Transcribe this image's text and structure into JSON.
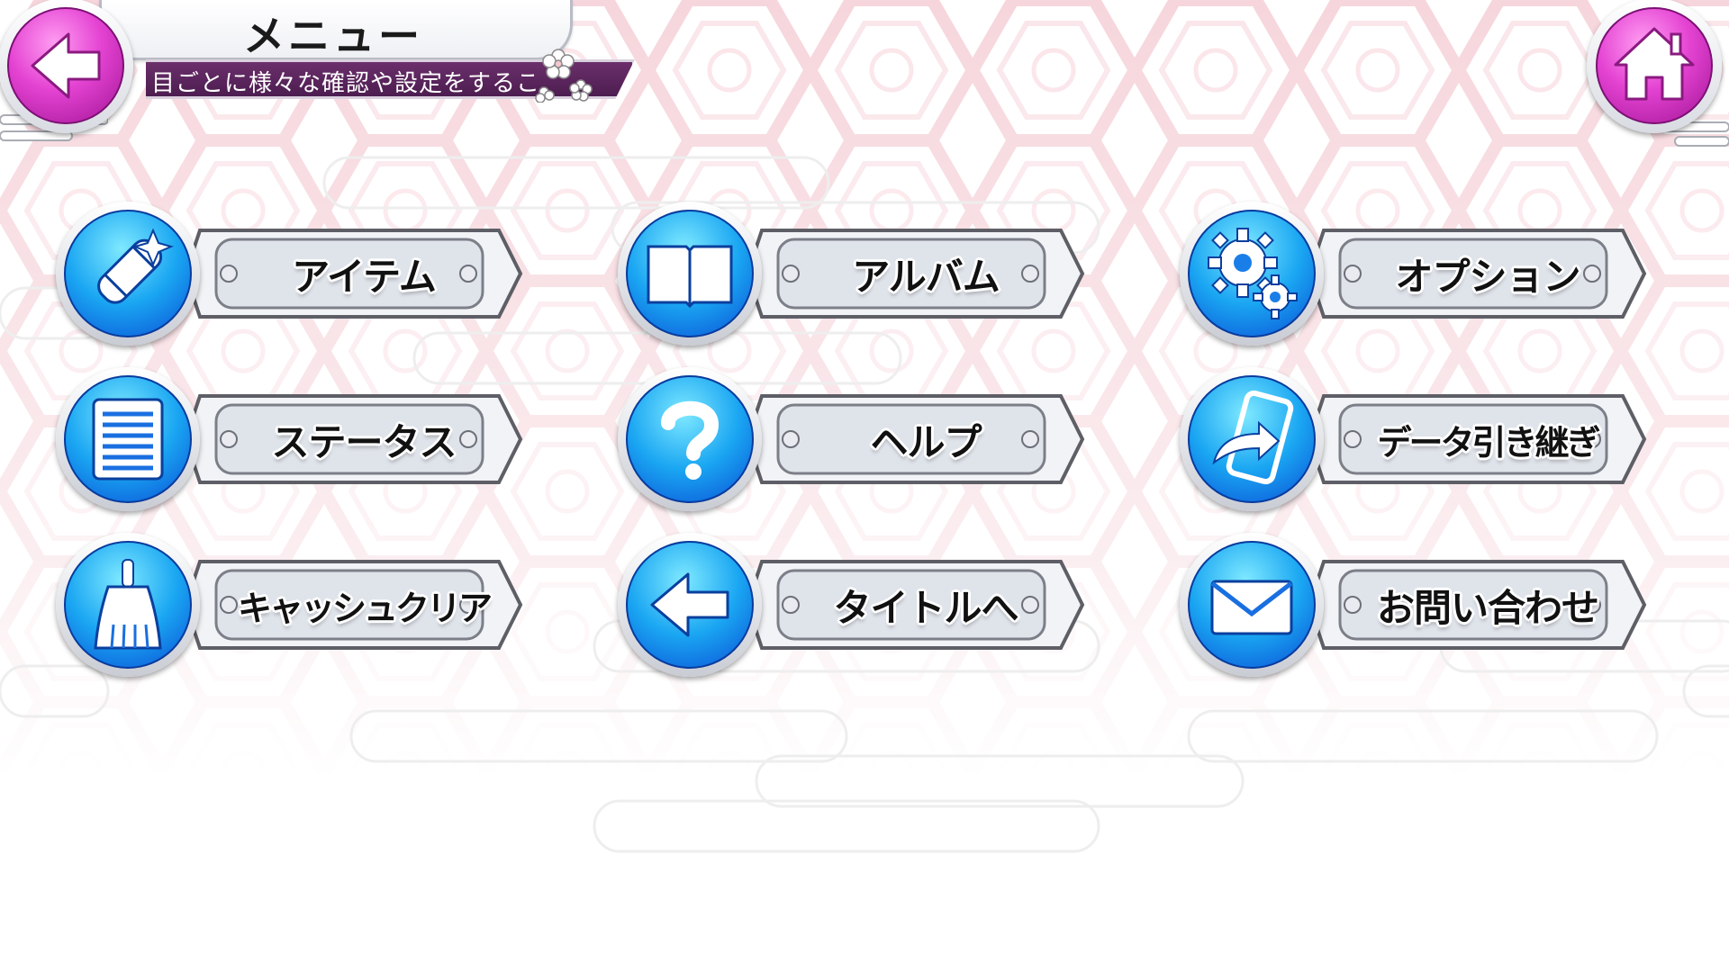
{
  "header": {
    "title": "メニュー",
    "subtitle": "目ごとに様々な確認や設定をするこ",
    "back_icon": "back-arrow-icon",
    "home_icon": "home-icon"
  },
  "menu": {
    "items": [
      {
        "label": "アイテム",
        "icon": "item-scroll-shuriken-icon"
      },
      {
        "label": "アルバム",
        "icon": "album-book-icon"
      },
      {
        "label": "オプション",
        "icon": "gear-icon"
      },
      {
        "label": "ステータス",
        "icon": "status-list-icon"
      },
      {
        "label": "ヘルプ",
        "icon": "help-question-icon"
      },
      {
        "label": "データ引き継ぎ",
        "icon": "phone-transfer-icon"
      },
      {
        "label": "キャッシュクリア",
        "icon": "broom-icon"
      },
      {
        "label": "タイトルへ",
        "icon": "back-arrow-icon"
      },
      {
        "label": "お問い合わせ",
        "icon": "mail-envelope-icon"
      }
    ]
  },
  "colors": {
    "accent_pink": "#e443d2",
    "accent_blue": "#1aa6f2",
    "subtitle_bar": "#5a2460",
    "pattern_pink": "#f7dde2"
  }
}
